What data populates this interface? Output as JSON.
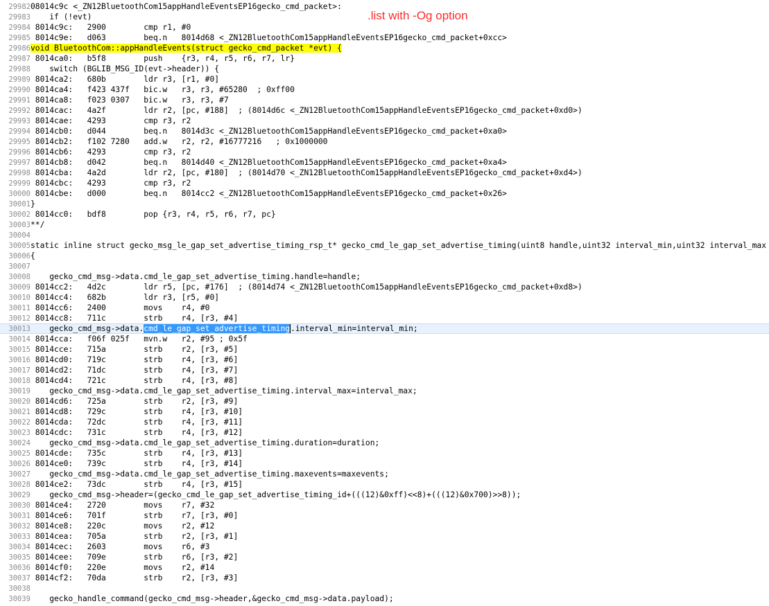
{
  "note": ".list with -Og option",
  "lines": [
    {
      "ln": "29982",
      "segs": [
        {
          "t": "08014c9c <_ZN12BluetoothCom15appHandleEventsEP16gecko_cmd_packet>:"
        }
      ]
    },
    {
      "ln": "29983",
      "segs": [
        {
          "t": "    if (!evt)"
        }
      ]
    },
    {
      "ln": "29984",
      "segs": [
        {
          "t": " 8014c9c:   2900        cmp r1, #0"
        }
      ]
    },
    {
      "ln": "29985",
      "segs": [
        {
          "t": " 8014c9e:   d063        beq.n   8014d68 <_ZN12BluetoothCom15appHandleEventsEP16gecko_cmd_packet+0xcc>"
        }
      ]
    },
    {
      "ln": "29986",
      "segs": [
        {
          "t": "void BluetoothCom::appHandleEvents(struct gecko_cmd_packet *evt) {",
          "c": "hl-yellow"
        }
      ]
    },
    {
      "ln": "29987",
      "segs": [
        {
          "t": " 8014ca0:   b5f8        push    {r3, r4, r5, r6, r7, lr}"
        }
      ]
    },
    {
      "ln": "29988",
      "segs": [
        {
          "t": "    switch (BGLIB_MSG_ID(evt->header)) {"
        }
      ]
    },
    {
      "ln": "29989",
      "segs": [
        {
          "t": " 8014ca2:   680b        ldr r3, [r1, #0]"
        }
      ]
    },
    {
      "ln": "29990",
      "segs": [
        {
          "t": " 8014ca4:   f423 437f   bic.w   r3, r3, #65280  ; 0xff00"
        }
      ]
    },
    {
      "ln": "29991",
      "segs": [
        {
          "t": " 8014ca8:   f023 0307   bic.w   r3, r3, #7"
        }
      ]
    },
    {
      "ln": "29992",
      "segs": [
        {
          "t": " 8014cac:   4a2f        ldr r2, [pc, #188]  ; (8014d6c <_ZN12BluetoothCom15appHandleEventsEP16gecko_cmd_packet+0xd0>)"
        }
      ]
    },
    {
      "ln": "29993",
      "segs": [
        {
          "t": " 8014cae:   4293        cmp r3, r2"
        }
      ]
    },
    {
      "ln": "29994",
      "segs": [
        {
          "t": " 8014cb0:   d044        beq.n   8014d3c <_ZN12BluetoothCom15appHandleEventsEP16gecko_cmd_packet+0xa0>"
        }
      ]
    },
    {
      "ln": "29995",
      "segs": [
        {
          "t": " 8014cb2:   f102 7280   add.w   r2, r2, #16777216   ; 0x1000000"
        }
      ]
    },
    {
      "ln": "29996",
      "segs": [
        {
          "t": " 8014cb6:   4293        cmp r3, r2"
        }
      ]
    },
    {
      "ln": "29997",
      "segs": [
        {
          "t": " 8014cb8:   d042        beq.n   8014d40 <_ZN12BluetoothCom15appHandleEventsEP16gecko_cmd_packet+0xa4>"
        }
      ]
    },
    {
      "ln": "29998",
      "segs": [
        {
          "t": " 8014cba:   4a2d        ldr r2, [pc, #180]  ; (8014d70 <_ZN12BluetoothCom15appHandleEventsEP16gecko_cmd_packet+0xd4>)"
        }
      ]
    },
    {
      "ln": "29999",
      "segs": [
        {
          "t": " 8014cbc:   4293        cmp r3, r2"
        }
      ]
    },
    {
      "ln": "30000",
      "segs": [
        {
          "t": " 8014cbe:   d000        beq.n   8014cc2 <_ZN12BluetoothCom15appHandleEventsEP16gecko_cmd_packet+0x26>"
        }
      ]
    },
    {
      "ln": "30001",
      "segs": [
        {
          "t": "}"
        }
      ]
    },
    {
      "ln": "30002",
      "segs": [
        {
          "t": " 8014cc0:   bdf8        pop {r3, r4, r5, r6, r7, pc}"
        }
      ]
    },
    {
      "ln": "30003",
      "segs": [
        {
          "t": "**/"
        }
      ]
    },
    {
      "ln": "30004",
      "segs": [
        {
          "t": ""
        }
      ]
    },
    {
      "ln": "30005",
      "segs": [
        {
          "t": "static inline struct gecko_msg_le_gap_set_advertise_timing_rsp_t* gecko_cmd_le_gap_set_advertise_timing(uint8 handle,uint32 interval_min,uint32 interval_max"
        }
      ]
    },
    {
      "ln": "30006",
      "segs": [
        {
          "t": "{"
        }
      ]
    },
    {
      "ln": "30007",
      "segs": [
        {
          "t": ""
        }
      ]
    },
    {
      "ln": "30008",
      "segs": [
        {
          "t": "    gecko_cmd_msg->data.cmd_le_gap_set_advertise_timing.handle=handle;"
        }
      ]
    },
    {
      "ln": "30009",
      "segs": [
        {
          "t": " 8014cc2:   4d2c        ldr r5, [pc, #176]  ; (8014d74 <_ZN12BluetoothCom15appHandleEventsEP16gecko_cmd_packet+0xd8>)"
        }
      ]
    },
    {
      "ln": "30010",
      "segs": [
        {
          "t": " 8014cc4:   682b        ldr r3, [r5, #0]"
        }
      ]
    },
    {
      "ln": "30011",
      "segs": [
        {
          "t": " 8014cc6:   2400        movs    r4, #0"
        }
      ]
    },
    {
      "ln": "30012",
      "segs": [
        {
          "t": " 8014cc8:   711c        strb    r4, [r3, #4]"
        }
      ]
    },
    {
      "ln": "30013",
      "current": true,
      "segs": [
        {
          "t": "    gecko_cmd_msg->data."
        },
        {
          "t": "cmd_le_gap_set_advertise_timing",
          "c": "hl-sel"
        },
        {
          "caret": true
        },
        {
          "t": ".interval_min=interval_min;"
        }
      ]
    },
    {
      "ln": "30014",
      "segs": [
        {
          "t": " 8014cca:   f06f 025f   mvn.w   r2, #95 ; 0x5f"
        }
      ]
    },
    {
      "ln": "30015",
      "segs": [
        {
          "t": " 8014cce:   715a        strb    r2, [r3, #5]"
        }
      ]
    },
    {
      "ln": "30016",
      "segs": [
        {
          "t": " 8014cd0:   719c        strb    r4, [r3, #6]"
        }
      ]
    },
    {
      "ln": "30017",
      "segs": [
        {
          "t": " 8014cd2:   71dc        strb    r4, [r3, #7]"
        }
      ]
    },
    {
      "ln": "30018",
      "segs": [
        {
          "t": " 8014cd4:   721c        strb    r4, [r3, #8]"
        }
      ]
    },
    {
      "ln": "30019",
      "segs": [
        {
          "t": "    gecko_cmd_msg->data.cmd_le_gap_set_advertise_timing.interval_max=interval_max;"
        }
      ]
    },
    {
      "ln": "30020",
      "segs": [
        {
          "t": " 8014cd6:   725a        strb    r2, [r3, #9]"
        }
      ]
    },
    {
      "ln": "30021",
      "segs": [
        {
          "t": " 8014cd8:   729c        strb    r4, [r3, #10]"
        }
      ]
    },
    {
      "ln": "30022",
      "segs": [
        {
          "t": " 8014cda:   72dc        strb    r4, [r3, #11]"
        }
      ]
    },
    {
      "ln": "30023",
      "segs": [
        {
          "t": " 8014cdc:   731c        strb    r4, [r3, #12]"
        }
      ]
    },
    {
      "ln": "30024",
      "segs": [
        {
          "t": "    gecko_cmd_msg->data.cmd_le_gap_set_advertise_timing.duration=duration;"
        }
      ]
    },
    {
      "ln": "30025",
      "segs": [
        {
          "t": " 8014cde:   735c        strb    r4, [r3, #13]"
        }
      ]
    },
    {
      "ln": "30026",
      "segs": [
        {
          "t": " 8014ce0:   739c        strb    r4, [r3, #14]"
        }
      ]
    },
    {
      "ln": "30027",
      "segs": [
        {
          "t": "    gecko_cmd_msg->data.cmd_le_gap_set_advertise_timing.maxevents=maxevents;"
        }
      ]
    },
    {
      "ln": "30028",
      "segs": [
        {
          "t": " 8014ce2:   73dc        strb    r4, [r3, #15]"
        }
      ]
    },
    {
      "ln": "30029",
      "segs": [
        {
          "t": "    gecko_cmd_msg->header=(gecko_cmd_le_gap_set_advertise_timing_id+(((12)&0xff)<<8)+(((12)&0x700)>>8));"
        }
      ]
    },
    {
      "ln": "30030",
      "segs": [
        {
          "t": " 8014ce4:   2720        movs    r7, #32"
        }
      ]
    },
    {
      "ln": "30031",
      "segs": [
        {
          "t": " 8014ce6:   701f        strb    r7, [r3, #0]"
        }
      ]
    },
    {
      "ln": "30032",
      "segs": [
        {
          "t": " 8014ce8:   220c        movs    r2, #12"
        }
      ]
    },
    {
      "ln": "30033",
      "segs": [
        {
          "t": " 8014cea:   705a        strb    r2, [r3, #1]"
        }
      ]
    },
    {
      "ln": "30034",
      "segs": [
        {
          "t": " 8014cec:   2603        movs    r6, #3"
        }
      ]
    },
    {
      "ln": "30035",
      "segs": [
        {
          "t": " 8014cee:   709e        strb    r6, [r3, #2]"
        }
      ]
    },
    {
      "ln": "30036",
      "segs": [
        {
          "t": " 8014cf0:   220e        movs    r2, #14"
        }
      ]
    },
    {
      "ln": "30037",
      "segs": [
        {
          "t": " 8014cf2:   70da        strb    r2, [r3, #3]"
        }
      ]
    },
    {
      "ln": "30038",
      "segs": [
        {
          "t": ""
        }
      ]
    },
    {
      "ln": "30039",
      "segs": [
        {
          "t": "    gecko_handle_command(gecko_cmd_msg->header,&gecko_cmd_msg->data.payload);"
        }
      ]
    }
  ]
}
